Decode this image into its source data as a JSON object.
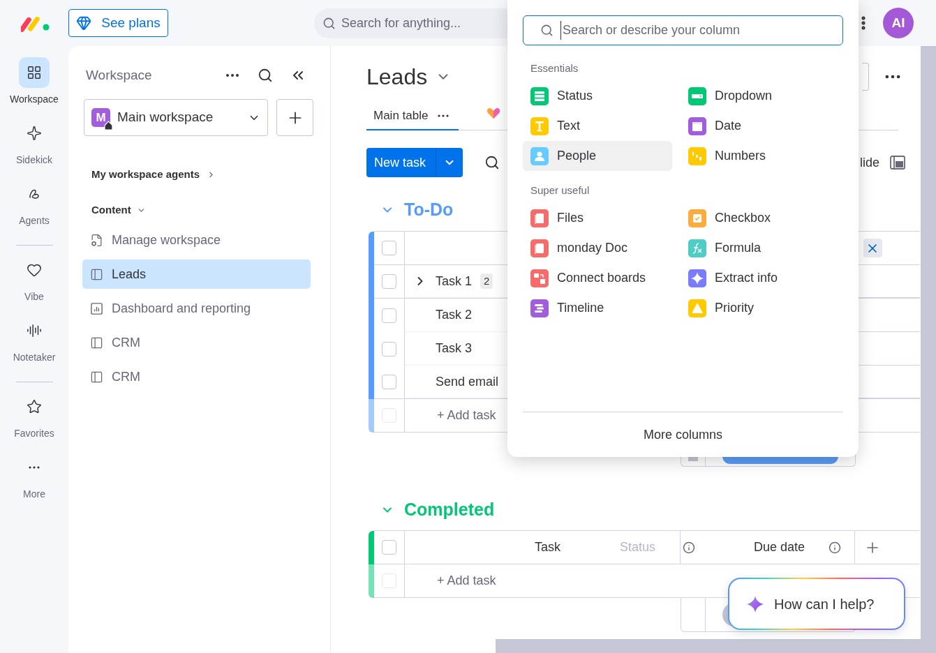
{
  "top_bar": {
    "upgrade_button": "See plans",
    "search": {
      "placeholder": "Search for anything..."
    },
    "avatar": "AI"
  },
  "rail": {
    "groups": [
      [
        {
          "label": "Workspace",
          "kind": "workspace",
          "selected": true
        },
        {
          "label": "Sidekick",
          "kind": "sidekick",
          "selected": false
        },
        {
          "label": "Agents",
          "kind": "agents",
          "selected": false
        }
      ],
      [
        {
          "label": "Vibe",
          "kind": "vibe",
          "selected": false
        },
        {
          "label": "Notetaker",
          "kind": "notetaker",
          "selected": false
        }
      ],
      [
        {
          "label": "Favorites",
          "kind": "favorites",
          "selected": false
        },
        {
          "label": "More",
          "kind": "more",
          "selected": false
        }
      ]
    ]
  },
  "sidebar": {
    "title": "Workspace",
    "workspace_select": {
      "badge": "M",
      "value": "Main workspace"
    },
    "agents_link": "My workspace agents",
    "content_section": {
      "label": "Content",
      "expanded": true
    },
    "items": [
      {
        "label": "Manage workspace",
        "kind": "settings",
        "selected": false
      },
      {
        "label": "Leads",
        "kind": "board",
        "selected": true
      },
      {
        "label": "Dashboard and reporting",
        "kind": "dashboard",
        "selected": false
      },
      {
        "label": "CRM",
        "kind": "board",
        "selected": false
      },
      {
        "label": "CRM",
        "kind": "board",
        "selected": false
      }
    ]
  },
  "board": {
    "title": "Leads",
    "views": [
      {
        "label": "Main table",
        "selected": true
      }
    ],
    "new_button": "New task",
    "toolbar_partial_label": "lide",
    "groups": [
      {
        "title": "To-Do",
        "color": "#579bfc",
        "expanded": true,
        "all_checked": false,
        "add_checkbox_disabled": true,
        "add_label": "+ Add task",
        "rows": [
          {
            "name": "Task 1",
            "subitems_count": "2",
            "checked": false
          },
          {
            "name": "Task 2",
            "checked": false
          },
          {
            "name": "Task 3",
            "checked": false
          },
          {
            "name": "Send email",
            "checked": false
          }
        ]
      },
      {
        "title": "Completed",
        "color": "#00c875",
        "expanded": true,
        "all_checked": false,
        "add_checkbox_disabled": true,
        "add_label": "+ Add task",
        "columns": [
          "Task",
          "Status",
          "Due date"
        ]
      }
    ]
  },
  "column_picker": {
    "search": {
      "placeholder": "Search or describe your column"
    },
    "sections": [
      {
        "title": "Essentials",
        "items": [
          {
            "label": "Status",
            "kind": "status",
            "color": "#00c875",
            "selected": false
          },
          {
            "label": "Dropdown",
            "kind": "dropdown",
            "color": "#00c875",
            "selected": false
          },
          {
            "label": "Text",
            "kind": "text",
            "color": "#ffcb00",
            "selected": false
          },
          {
            "label": "Date",
            "kind": "date",
            "color": "#a25ddc",
            "selected": false
          },
          {
            "label": "People",
            "kind": "people",
            "color": "#66ccff",
            "selected": true
          },
          {
            "label": "Numbers",
            "kind": "numbers",
            "color": "#ffcb00",
            "selected": false
          }
        ]
      },
      {
        "title": "Super useful",
        "items": [
          {
            "label": "Files",
            "kind": "files",
            "color": "#f76b6b",
            "selected": false
          },
          {
            "label": "Checkbox",
            "kind": "checkbox",
            "color": "#fdab3d",
            "selected": false
          },
          {
            "label": "monday Doc",
            "kind": "doc",
            "color": "#f76b6b",
            "selected": false
          },
          {
            "label": "Formula",
            "kind": "formula",
            "color": "#4eccc6",
            "selected": false
          },
          {
            "label": "Connect boards",
            "kind": "connect",
            "color": "#f76b6b",
            "selected": false
          },
          {
            "label": "Extract info",
            "kind": "extract",
            "color": "#7b7bff",
            "selected": false
          },
          {
            "label": "Timeline",
            "kind": "timeline",
            "color": "#a25ddc",
            "selected": false
          },
          {
            "label": "Priority",
            "kind": "priority",
            "color": "#ffcb00",
            "selected": false
          }
        ]
      }
    ],
    "footer": "More columns"
  },
  "assistant": {
    "prompt": "How can I help?"
  }
}
